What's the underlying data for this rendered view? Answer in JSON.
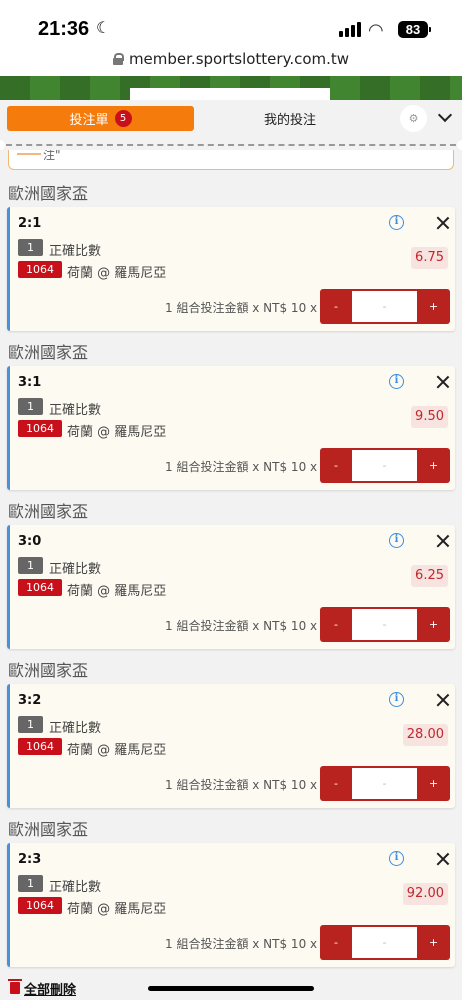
{
  "status_bar": {
    "time": "21:36",
    "battery": "83"
  },
  "url": "member.sportslottery.com.tw",
  "header": {
    "tab_betslip": "投注單",
    "betslip_count": "5",
    "tab_my_bets": "我的投注"
  },
  "notice_text": "注\"",
  "bets": [
    {
      "league": "歐洲國家盃",
      "score": "2:1",
      "qty": "1",
      "market": "正確比數",
      "match_code": "1064",
      "match": "荷蘭 @ 羅馬尼亞",
      "odds": "6.75",
      "stake_label": "1 組合投注金額 x NT$ 10 x",
      "minus": "-",
      "amount": "-",
      "plus": "+"
    },
    {
      "league": "歐洲國家盃",
      "score": "3:1",
      "qty": "1",
      "market": "正確比數",
      "match_code": "1064",
      "match": "荷蘭 @ 羅馬尼亞",
      "odds": "9.50",
      "stake_label": "1 組合投注金額 x NT$ 10 x",
      "minus": "-",
      "amount": "-",
      "plus": "+"
    },
    {
      "league": "歐洲國家盃",
      "score": "3:0",
      "qty": "1",
      "market": "正確比數",
      "match_code": "1064",
      "match": "荷蘭 @ 羅馬尼亞",
      "odds": "6.25",
      "stake_label": "1 組合投注金額 x NT$ 10 x",
      "minus": "-",
      "amount": "-",
      "plus": "+"
    },
    {
      "league": "歐洲國家盃",
      "score": "3:2",
      "qty": "1",
      "market": "正確比數",
      "match_code": "1064",
      "match": "荷蘭 @ 羅馬尼亞",
      "odds": "28.00",
      "stake_label": "1 組合投注金額 x NT$ 10 x",
      "minus": "-",
      "amount": "-",
      "plus": "+"
    },
    {
      "league": "歐洲國家盃",
      "score": "2:3",
      "qty": "1",
      "market": "正確比數",
      "match_code": "1064",
      "match": "荷蘭 @ 羅馬尼亞",
      "odds": "92.00",
      "stake_label": "1 組合投注金額 x NT$ 10 x",
      "minus": "-",
      "amount": "-",
      "plus": "+"
    }
  ],
  "footer": {
    "delete_all": "全部刪除"
  },
  "icons": {
    "info": "info-icon",
    "close": "close-icon",
    "settings": "gear-icon",
    "collapse": "chevron-down-icon",
    "delete": "trash-icon",
    "lock": "lock-icon"
  },
  "colors": {
    "accent_orange": "#f47b0c",
    "badge_red": "#c8101a",
    "stepper_red": "#b8221f",
    "info_blue": "#3b8ee0",
    "card_bg": "#fdfaf2",
    "odds_bg": "#f7e3df"
  }
}
